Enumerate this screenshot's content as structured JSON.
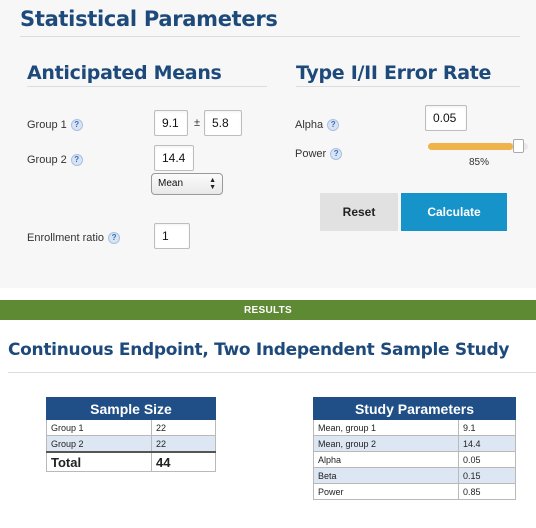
{
  "statistical_parameters": {
    "title": "Statistical Parameters",
    "anticipated_means": {
      "title": "Anticipated Means",
      "group1_label": "Group 1",
      "group1_mean": "9.1",
      "plus_minus": "±",
      "group1_sd": "5.8",
      "group2_label": "Group 2",
      "group2_mean": "14.4",
      "statistic_select": "Mean",
      "enrollment_ratio_label": "Enrollment ratio",
      "enrollment_ratio": "1",
      "help_glyph": "?"
    },
    "error_rate": {
      "title": "Type I/II Error Rate",
      "alpha_label": "Alpha",
      "alpha": "0.05",
      "power_label": "Power",
      "power_display": "85%",
      "power_fraction": 0.85
    },
    "buttons": {
      "reset": "Reset",
      "calculate": "Calculate"
    }
  },
  "results": {
    "bar_label": "RESULTS",
    "study_title": "Continuous Endpoint, Two Independent Sample Study",
    "sample_size": {
      "title": "Sample Size",
      "rows": [
        {
          "label": "Group 1",
          "value": "22"
        },
        {
          "label": "Group 2",
          "value": "22"
        }
      ],
      "total_label": "Total",
      "total_value": "44"
    },
    "study_parameters": {
      "title": "Study Parameters",
      "rows": [
        {
          "label": "Mean, group 1",
          "value": "9.1"
        },
        {
          "label": "Mean, group 2",
          "value": "14.4"
        },
        {
          "label": "Alpha",
          "value": "0.05"
        },
        {
          "label": "Beta",
          "value": "0.15"
        },
        {
          "label": "Power",
          "value": "0.85"
        }
      ]
    }
  },
  "colors": {
    "heading": "#1d4a7a",
    "accent_button": "#1694c9",
    "results_bar": "#5f8a34",
    "slider_fill": "#f0b24a",
    "table_header": "#1f4f86"
  }
}
